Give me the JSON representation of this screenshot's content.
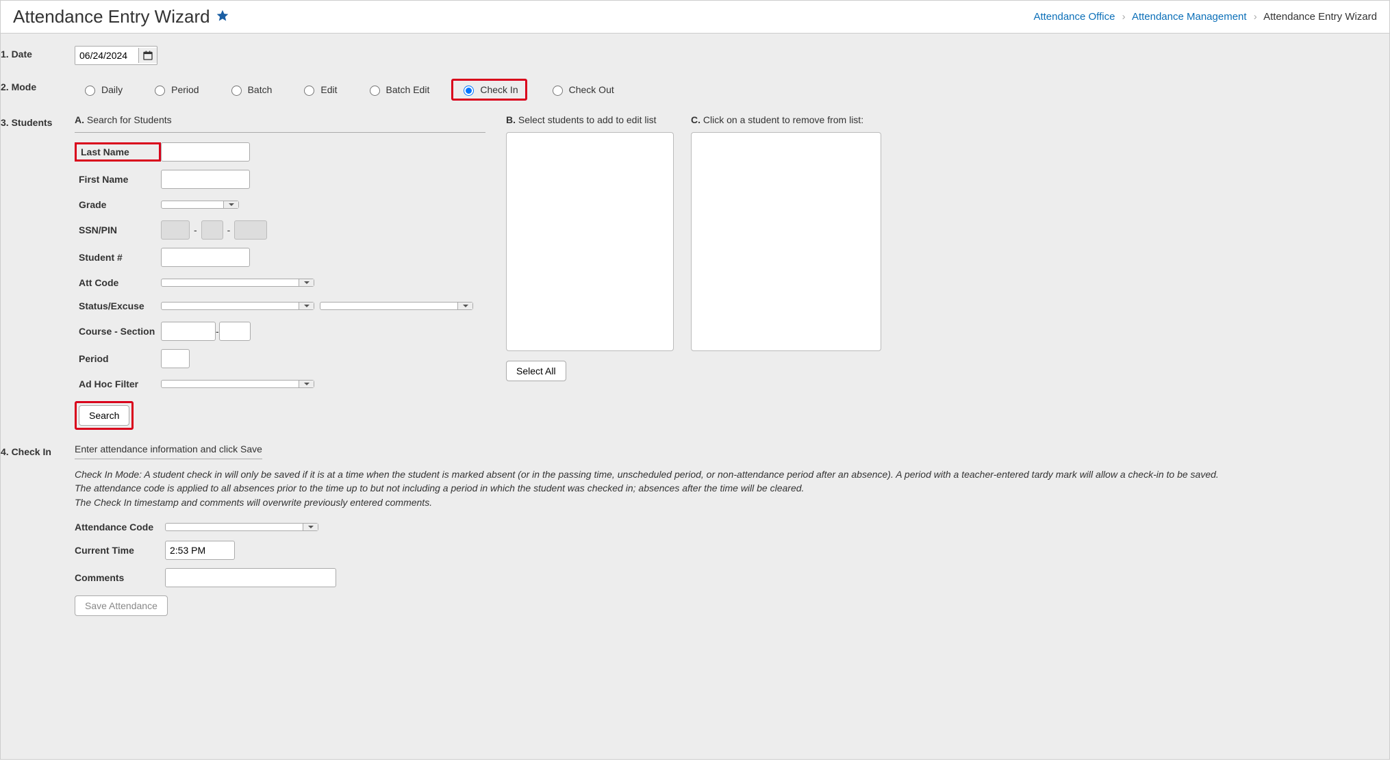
{
  "header": {
    "title": "Attendance Entry Wizard",
    "breadcrumbs": [
      "Attendance Office",
      "Attendance Management",
      "Attendance Entry Wizard"
    ]
  },
  "steps": {
    "date": {
      "label": "1. Date",
      "value": "06/24/2024"
    },
    "mode": {
      "label": "2. Mode",
      "options": [
        "Daily",
        "Period",
        "Batch",
        "Edit",
        "Batch Edit",
        "Check In",
        "Check Out"
      ],
      "selected": "Check In"
    },
    "students": {
      "label": "3. Students",
      "a_title_prefix": "A.",
      "a_title": "Search for Students",
      "b_title_prefix": "B.",
      "b_title": "Select students to add to edit list",
      "c_title_prefix": "C.",
      "c_title": "Click on a student to remove from list:",
      "fields": {
        "last_name": "Last Name",
        "first_name": "First Name",
        "grade": "Grade",
        "ssn": "SSN/PIN",
        "student_num": "Student #",
        "att_code": "Att Code",
        "status_excuse": "Status/Excuse",
        "course_section": "Course - Section",
        "period": "Period",
        "adhoc": "Ad Hoc Filter"
      },
      "search_btn": "Search",
      "select_all_btn": "Select All"
    },
    "checkin": {
      "label": "4. Check In",
      "subhead": "Enter attendance information and click Save",
      "note1": "Check In Mode: A student check in will only be saved if it is at a time when the student is marked absent (or in the passing time, unscheduled period, or non-attendance period after an absence). A period with a teacher-entered tardy mark will allow a check-in to be saved.",
      "note2": "The attendance code is applied to all absences prior to the time up to but not including a period in which the student was checked in; absences after the time will be cleared.",
      "note3": "The Check In timestamp and comments will overwrite previously entered comments.",
      "att_code_label": "Attendance Code",
      "time_label": "Current Time",
      "time_value": "2:53 PM",
      "comments_label": "Comments",
      "save_btn": "Save Attendance"
    }
  }
}
